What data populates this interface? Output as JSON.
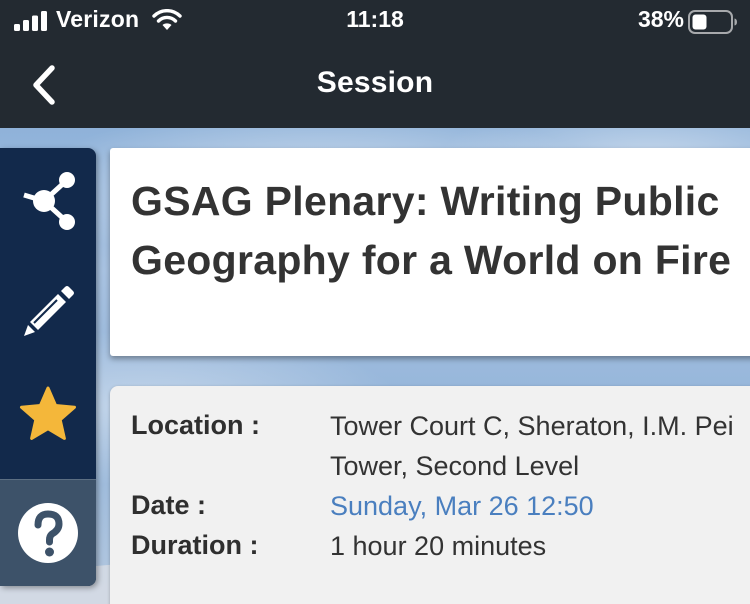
{
  "status_bar": {
    "carrier": "Verizon",
    "time": "11:18",
    "battery_percent": "38%",
    "icons": [
      "signal-icon",
      "wifi-icon",
      "battery-icon"
    ]
  },
  "nav": {
    "title": "Session",
    "back_icon": "chevron-left-icon"
  },
  "sidebar": {
    "items": [
      {
        "name": "share",
        "icon": "share-icon"
      },
      {
        "name": "notes",
        "icon": "pencil-icon"
      },
      {
        "name": "favorite",
        "icon": "star-icon"
      },
      {
        "name": "help",
        "icon": "help-icon"
      }
    ]
  },
  "session": {
    "title": "GSAG Plenary: Writing Public Geography for a World on Fire",
    "location_label": "Location :",
    "location_value": "Tower Court C, Sheraton, I.M. Pei Tower, Second Level",
    "date_label": "Date :",
    "date_value": "Sunday, Mar 26 12:50",
    "duration_label": "Duration :",
    "duration_value": "1 hour 20 minutes"
  },
  "colors": {
    "topbar": "#232a31",
    "sidebar": "#12294b",
    "star": "#f4b73a",
    "link": "#4a7fbf"
  }
}
